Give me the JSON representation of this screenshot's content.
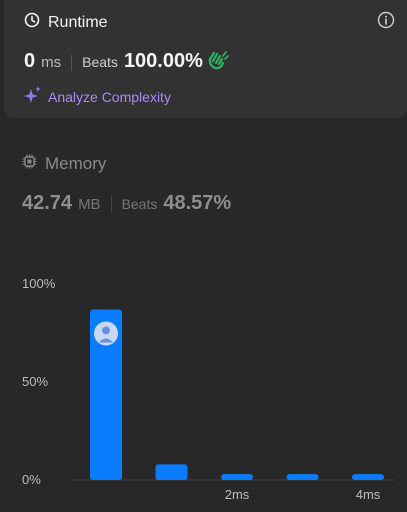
{
  "runtime": {
    "title": "Runtime",
    "value": "0",
    "unit": "ms",
    "beats_label": "Beats",
    "beats_value": "100.00%",
    "analyze_label": "Analyze Complexity"
  },
  "memory": {
    "title": "Memory",
    "value": "42.74",
    "unit": "MB",
    "beats_label": "Beats",
    "beats_value": "48.57%"
  },
  "colors": {
    "bar": "#0a7cff",
    "accent_purple": "#a78bfa",
    "hands": "#2db55d"
  },
  "chart_data": {
    "type": "bar",
    "y_ticks": [
      "100%",
      "50%",
      "0%"
    ],
    "x_ticks": [
      "2ms",
      "4ms"
    ],
    "ylim": [
      0,
      100
    ],
    "values": [
      87,
      8,
      3,
      3,
      3
    ],
    "highlight_index": 0
  }
}
